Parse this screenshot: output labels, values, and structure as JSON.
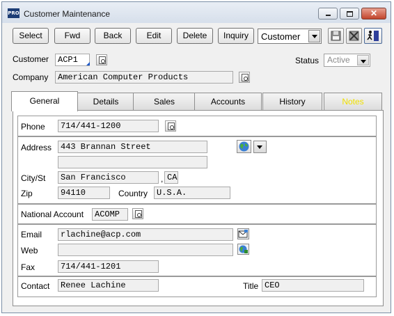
{
  "window": {
    "app_badge": "PRO",
    "title": "Customer Maintenance",
    "close_glyph": "✕"
  },
  "toolbar": {
    "select_label": "Select",
    "fwd_label": "Fwd",
    "back_label": "Back",
    "edit_label": "Edit",
    "delete_label": "Delete",
    "inquiry_label": "Inquiry",
    "mode_value": "Customer",
    "save_icon": "save-icon",
    "cancel_icon": "cancel-icon",
    "exit_icon": "exit-icon"
  },
  "header": {
    "customer_label": "Customer",
    "customer_value": "ACP1",
    "company_label": "Company",
    "company_value": "American Computer Products",
    "status_label": "Status",
    "status_value": "Active"
  },
  "tabs": [
    {
      "label": "General",
      "active": true
    },
    {
      "label": "Details"
    },
    {
      "label": "Sales"
    },
    {
      "label": "Accounts"
    },
    {
      "label": "History"
    },
    {
      "label": "Notes",
      "color": "#f0e000"
    }
  ],
  "general": {
    "phone_label": "Phone",
    "phone_value": "714/441-1200",
    "address_label": "Address",
    "address_line1": "443 Brannan Street",
    "address_line2": "",
    "city_label": "City/St",
    "city_value": "San Francisco",
    "city_sep": ",",
    "state_value": "CA",
    "zip_label": "Zip",
    "zip_value": "94110",
    "country_label": "Country",
    "country_value": "U.S.A.",
    "national_label": "National Account",
    "national_value": "ACOMP",
    "email_label": "Email",
    "email_value": "rlachine@acp.com",
    "web_label": "Web",
    "web_value": "",
    "fax_label": "Fax",
    "fax_value": "714/441-1201",
    "contact_label": "Contact",
    "contact_value": "Renee Lachine",
    "title_label": "Title",
    "title_value": "CEO"
  },
  "colors": {
    "titlebar": "#dce4ef",
    "notes_tab_text": "#f0e000",
    "close_button": "#c2452c"
  }
}
